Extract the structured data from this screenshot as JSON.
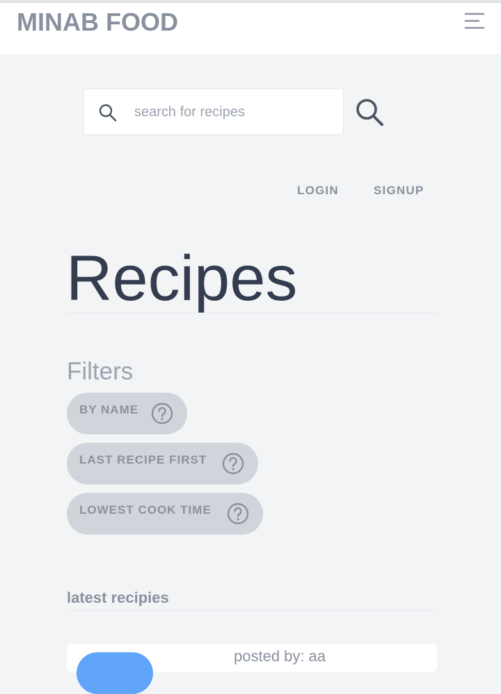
{
  "header": {
    "brand": "MINAB FOOD",
    "menu_icon": "hamburger-menu-icon"
  },
  "search": {
    "placeholder": "search for recipes",
    "value": "",
    "input_icon": "search-icon",
    "submit_icon": "search-icon"
  },
  "auth": {
    "login_label": "LOGIN",
    "signup_label": "SIGNUP"
  },
  "main": {
    "title": "Recipes",
    "filters_heading": "Filters",
    "filters": [
      {
        "label": "BY NAME",
        "icon": "help-circle-icon"
      },
      {
        "label": "LAST RECIPE FIRST",
        "icon": "help-circle-icon"
      },
      {
        "label": "LOWEST COOK TIME",
        "icon": "help-circle-icon"
      }
    ],
    "latest_heading": "latest recipies",
    "recipes": [
      {
        "posted_by_label": "posted by:",
        "author": "aa"
      }
    ]
  },
  "colors": {
    "background": "#f3f4f6",
    "title_text": "#333d4f",
    "muted_text": "#8a919e",
    "pill_bg": "#d1d5db",
    "accent_blue": "#60a5fa"
  }
}
